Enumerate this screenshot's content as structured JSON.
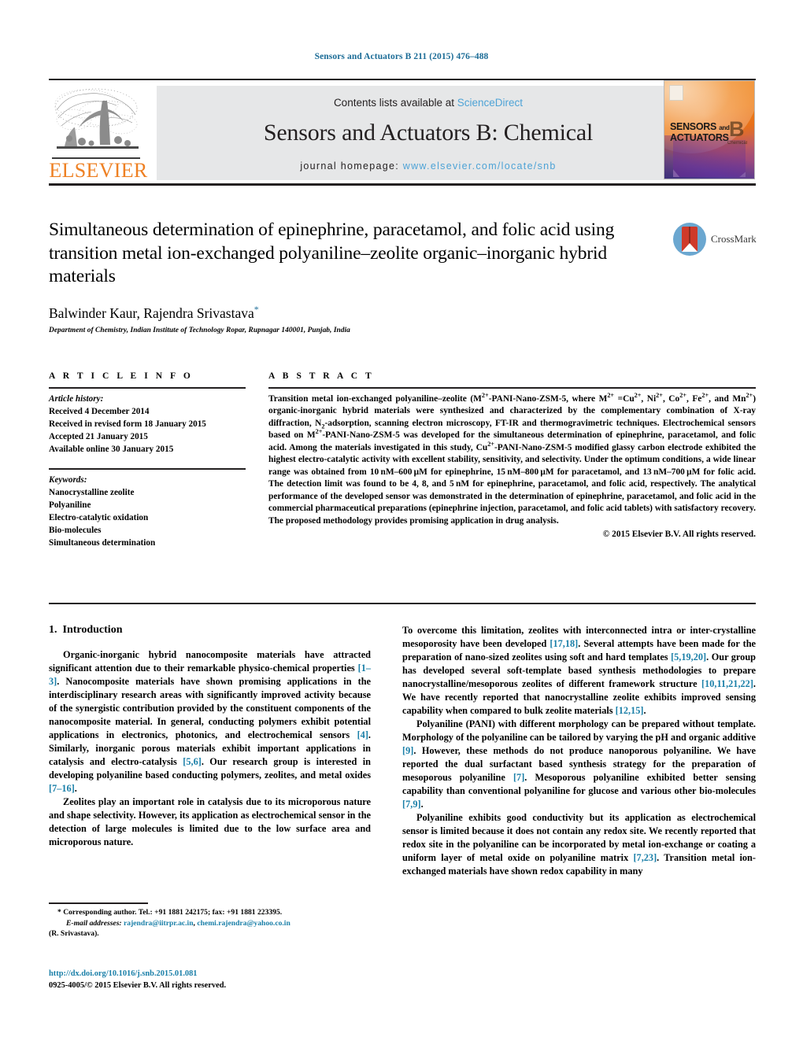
{
  "running_head": "Sensors and Actuators B 211 (2015) 476–488",
  "masthead": {
    "contents_prefix": "Contents lists available at ",
    "sciencedirect": "ScienceDirect",
    "journal_title": "Sensors and Actuators B: Chemical",
    "homepage_prefix": "journal homepage: ",
    "homepage_url": "www.elsevier.com/locate/snb",
    "publisher_logo_text": "ELSEVIER",
    "cover": {
      "line1": "SENSORS",
      "and": "and",
      "line2": "ACTUATORS",
      "series": "B",
      "series_sub": "Chemical"
    },
    "colors": {
      "link": "#4ea3d6",
      "panel_bg": "#e6e7e8",
      "elsevier_orange": "#ee8023",
      "running_head": "#1a6b96"
    }
  },
  "article": {
    "title": "Simultaneous determination of epinephrine, paracetamol, and folic acid using transition metal ion-exchanged polyaniline–zeolite organic–inorganic hybrid materials",
    "authors": "Balwinder Kaur, Rajendra Srivastava",
    "corresponding_marker": "*",
    "affiliation": "Department of Chemistry, Indian Institute of Technology Ropar, Rupnagar 140001, Punjab, India",
    "crossmark_label": "CrossMark"
  },
  "info": {
    "heading": "A R T I C L E   I N F O",
    "history_label": "Article history:",
    "history": [
      "Received 4 December 2014",
      "Received in revised form 18 January 2015",
      "Accepted 21 January 2015",
      "Available online 30 January 2015"
    ],
    "keywords_label": "Keywords:",
    "keywords": [
      "Nanocrystalline zeolite",
      "Polyaniline",
      "Electro-catalytic oxidation",
      "Bio-molecules",
      "Simultaneous determination"
    ]
  },
  "abstract": {
    "heading": "A B S T R A C T",
    "copyright": "© 2015 Elsevier B.V. All rights reserved."
  },
  "body": {
    "section_number": "1.",
    "section_title": "Introduction"
  },
  "footnote": {
    "corresponding": "* Corresponding author. Tel.: +91 1881 242175; fax: +91 1881 223395.",
    "email_label": "E-mail addresses:",
    "email1": "rajendra@iitrpr.ac.in",
    "email_sep": ", ",
    "email2": "chemi.rajendra@yahoo.co.in",
    "email_owner": "(R. Srivastava)."
  },
  "doi": {
    "url": "http://dx.doi.org/10.1016/j.snb.2015.01.081",
    "issn_line": "0925-4005/© 2015 Elsevier B.V. All rights reserved."
  }
}
